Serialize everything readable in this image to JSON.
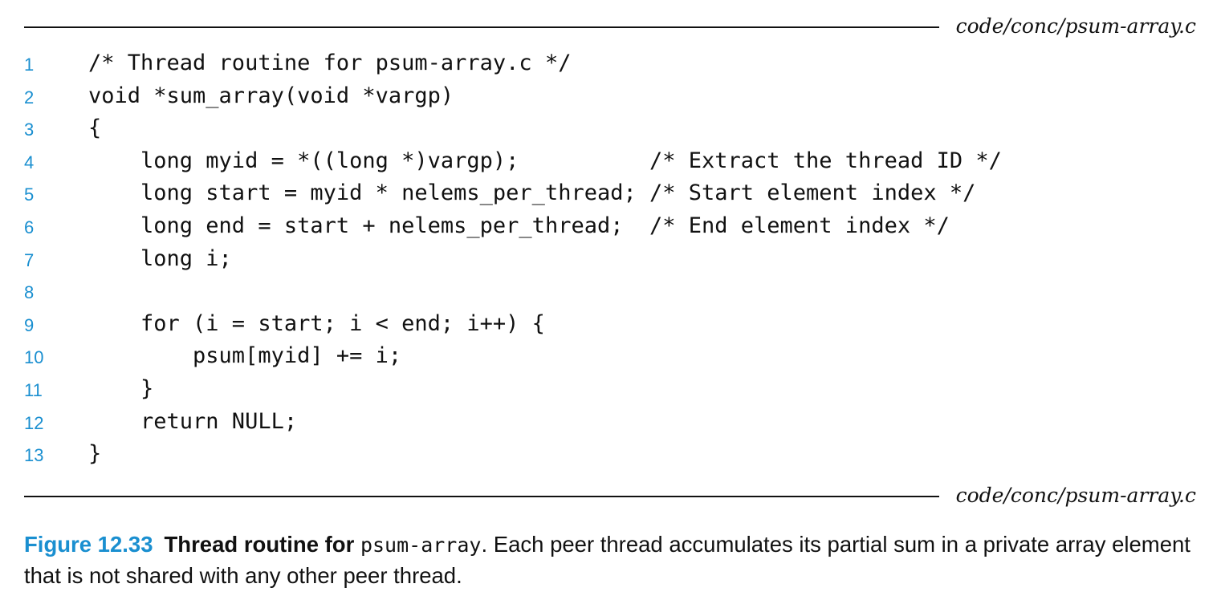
{
  "source_path": "code/conc/psum-array.c",
  "code_lines": [
    {
      "num": "1",
      "text": "/* Thread routine for psum-array.c */"
    },
    {
      "num": "2",
      "text": "void *sum_array(void *vargp)"
    },
    {
      "num": "3",
      "text": "{"
    },
    {
      "num": "4",
      "text": "    long myid = *((long *)vargp);          /* Extract the thread ID */"
    },
    {
      "num": "5",
      "text": "    long start = myid * nelems_per_thread; /* Start element index */"
    },
    {
      "num": "6",
      "text": "    long end = start + nelems_per_thread;  /* End element index */"
    },
    {
      "num": "7",
      "text": "    long i;"
    },
    {
      "num": "8",
      "text": ""
    },
    {
      "num": "9",
      "text": "    for (i = start; i < end; i++) {"
    },
    {
      "num": "10",
      "text": "        psum[myid] += i;"
    },
    {
      "num": "11",
      "text": "    }"
    },
    {
      "num": "12",
      "text": "    return NULL;"
    },
    {
      "num": "13",
      "text": "}"
    }
  ],
  "caption": {
    "label": "Figure 12.33",
    "title": "Thread routine for",
    "title_code": "psum-array",
    "text": ". Each peer thread accumulates its partial sum in a private array element that is not shared with any other peer thread."
  },
  "colors": {
    "accent": "#1a8fd0",
    "text": "#111111"
  }
}
